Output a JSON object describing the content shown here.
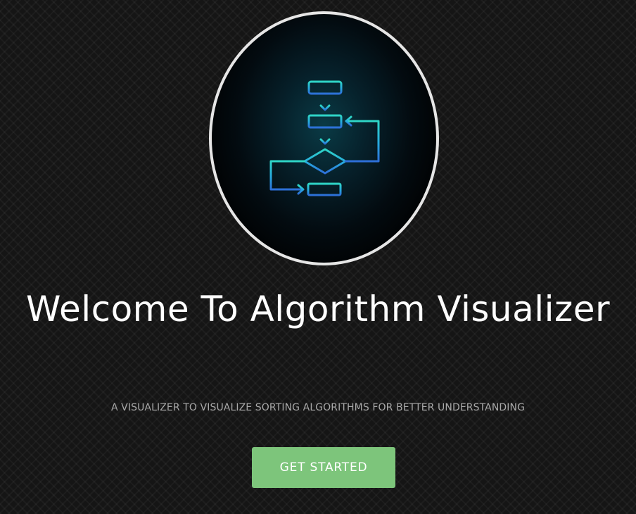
{
  "hero": {
    "logo_icon": "flowchart-icon",
    "title": "Welcome To Algorithm Visualizer",
    "subtitle": "A VISUALIZER TO VISUALIZE SORTING ALGORITHMS FOR BETTER UNDERSTANDING",
    "cta_label": "GET STARTED"
  },
  "colors": {
    "background": "#151515",
    "title": "#ffffff",
    "subtitle": "#a9a9a9",
    "cta_background": "#7dc57b",
    "cta_text": "#ffffff",
    "logo_border": "#e6e6e6",
    "flowchart_cyan": "#2fd6c6",
    "flowchart_blue": "#2d6fd8"
  }
}
